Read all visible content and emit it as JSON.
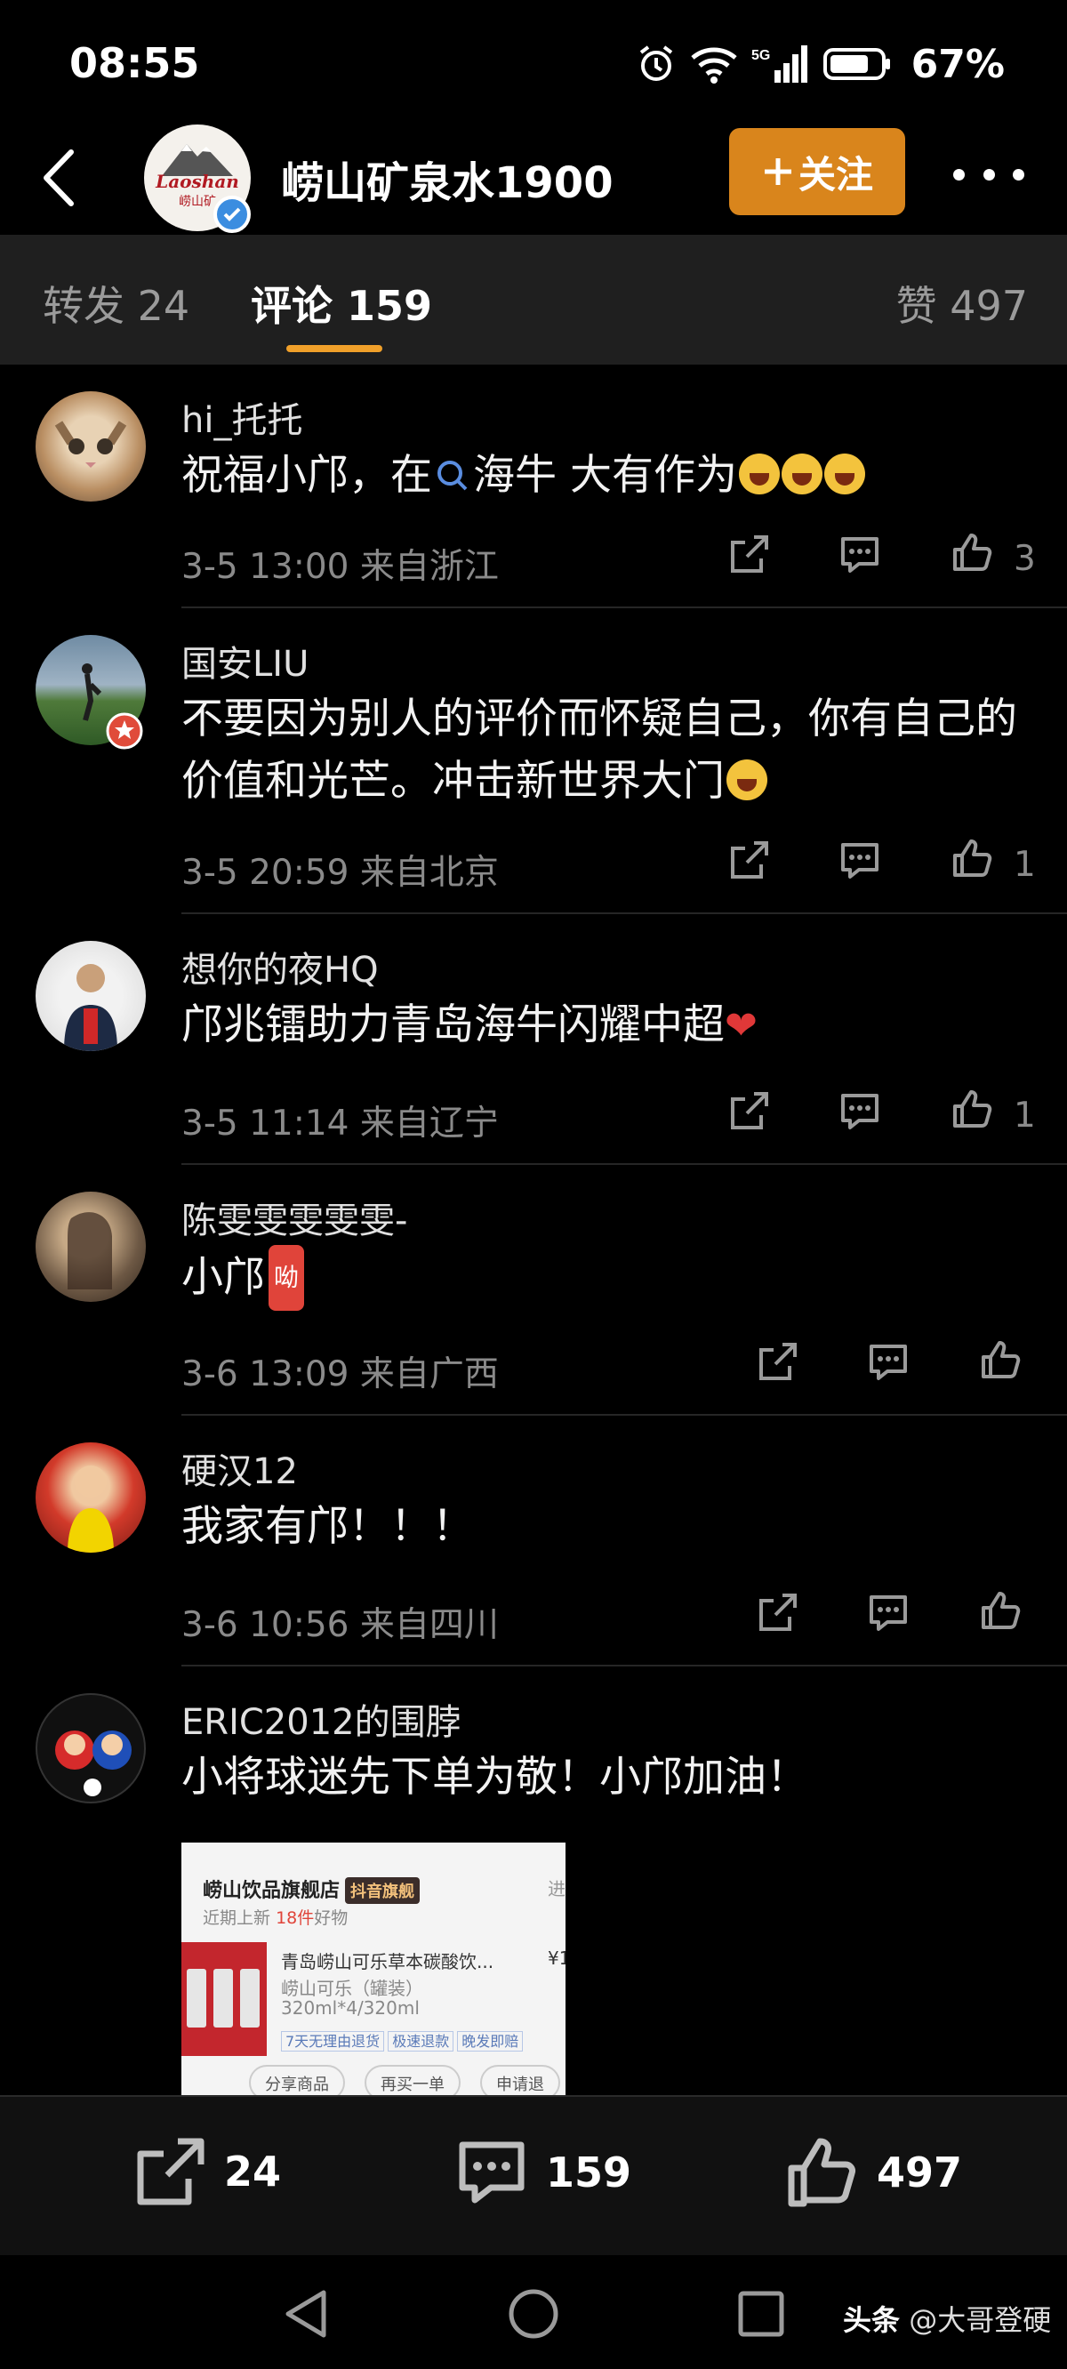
{
  "status_bar": {
    "time": "08:55",
    "network": "5G",
    "battery": "67%"
  },
  "header": {
    "account_name": "崂山矿泉水1900",
    "logo_text": "Laoshan",
    "logo_subtext": "崂山矿",
    "follow_label": "关注"
  },
  "tabs": {
    "repost": "转发 24",
    "comments": "评论 159",
    "likes": "赞 497"
  },
  "comments": [
    {
      "username": "hi_托托",
      "text": "祝福小邝，在",
      "search_term": "海牛",
      "text_after": " 大有作为",
      "date": "3-5 13:00",
      "location": "来自浙江",
      "likes": "3"
    },
    {
      "username": "国安LIU",
      "text": "不要因为别人的评价而怀疑自己，你有自己的价值和光芒。冲击新世界大门",
      "date": "3-5 20:59",
      "location": "来自北京",
      "likes": "1"
    },
    {
      "username": "想你的夜HQ",
      "text": "邝兆镭助力青岛海牛闪耀中超",
      "date": "3-5 11:14",
      "location": "来自辽宁",
      "likes": "1"
    },
    {
      "username": "陈雯雯雯雯雯-",
      "text": "小邝",
      "badge": "呦",
      "date": "3-6 13:09",
      "location": "来自广西",
      "likes": ""
    },
    {
      "username": "硬汉12",
      "text": "我家有邝！！！",
      "date": "3-6 10:56",
      "location": "来自四川",
      "likes": ""
    },
    {
      "username": "ERIC2012的围脖",
      "text": "小将球迷先下单为敬！小邝加油！"
    }
  ],
  "product_card": {
    "store": "崂山饮品旗舰店",
    "store_badge": "抖音旗舰",
    "more": "进",
    "sub_prefix": "近期上新",
    "sub_count": "18件",
    "sub_suffix": "好物",
    "title": "青岛崂山可乐草本碳酸饮...",
    "price": "¥1",
    "variant": "崂山可乐（罐装）",
    "spec": "320ml*4/320ml",
    "tags": [
      "7天无理由退货",
      "极速退款",
      "晚发即赔"
    ],
    "buttons": [
      "分享商品",
      "再买一单",
      "申请退"
    ]
  },
  "bottom_bar": {
    "reposts": "24",
    "comments": "159",
    "likes": "497"
  },
  "watermark": {
    "brand": "头条",
    "handle": "@大哥登硬"
  }
}
